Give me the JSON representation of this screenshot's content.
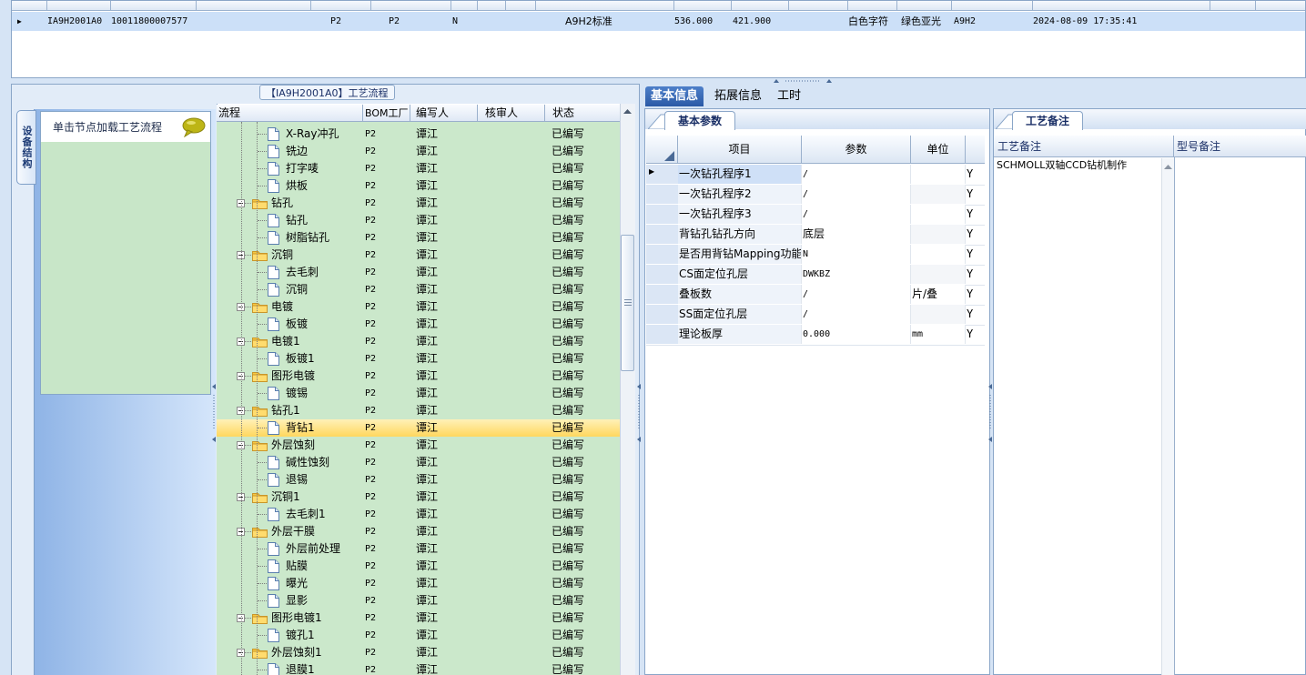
{
  "top_grid": {
    "row": {
      "id": "IA9H2001A0",
      "code": "10011800007577",
      "f1": "P2",
      "f2": "P2",
      "f3": "N",
      "standard": "A9H2标准",
      "v1": "536.000",
      "v2": "421.900",
      "char_color": "白色字符",
      "mask_color": "绿色亚光",
      "model": "A9H2",
      "datetime": "2024-08-09 17:35:41"
    }
  },
  "left_panel": {
    "title": "【IA9H2001A0】工艺流程",
    "vertical_tab": "设备结构",
    "load_hint": "单击节点加载工艺流程"
  },
  "tree": {
    "headers": [
      "流程",
      "BOM工厂",
      "编写人",
      "核审人",
      "状态"
    ],
    "rows": [
      {
        "name": "X-Ray冲孔",
        "level": 2,
        "bom": "P2",
        "author": "谭江",
        "reviewer": "",
        "status": "已编写"
      },
      {
        "name": "铣边",
        "level": 2,
        "bom": "P2",
        "author": "谭江",
        "reviewer": "",
        "status": "已编写"
      },
      {
        "name": "打字唛",
        "level": 2,
        "bom": "P2",
        "author": "谭江",
        "reviewer": "",
        "status": "已编写"
      },
      {
        "name": "烘板",
        "level": 2,
        "bom": "P2",
        "author": "谭江",
        "reviewer": "",
        "status": "已编写"
      },
      {
        "name": "钻孔",
        "level": 1,
        "bom": "P2",
        "author": "谭江",
        "reviewer": "",
        "status": "已编写"
      },
      {
        "name": "钻孔",
        "level": 2,
        "bom": "P2",
        "author": "谭江",
        "reviewer": "",
        "status": "已编写"
      },
      {
        "name": "树脂钻孔",
        "level": 2,
        "bom": "P2",
        "author": "谭江",
        "reviewer": "",
        "status": "已编写"
      },
      {
        "name": "沉铜",
        "level": 1,
        "bom": "P2",
        "author": "谭江",
        "reviewer": "",
        "status": "已编写"
      },
      {
        "name": "去毛刺",
        "level": 2,
        "bom": "P2",
        "author": "谭江",
        "reviewer": "",
        "status": "已编写"
      },
      {
        "name": "沉铜",
        "level": 2,
        "bom": "P2",
        "author": "谭江",
        "reviewer": "",
        "status": "已编写"
      },
      {
        "name": "电镀",
        "level": 1,
        "bom": "P2",
        "author": "谭江",
        "reviewer": "",
        "status": "已编写"
      },
      {
        "name": "板镀",
        "level": 2,
        "bom": "P2",
        "author": "谭江",
        "reviewer": "",
        "status": "已编写"
      },
      {
        "name": "电镀1",
        "level": 1,
        "bom": "P2",
        "author": "谭江",
        "reviewer": "",
        "status": "已编写"
      },
      {
        "name": "板镀1",
        "level": 2,
        "bom": "P2",
        "author": "谭江",
        "reviewer": "",
        "status": "已编写"
      },
      {
        "name": "图形电镀",
        "level": 1,
        "bom": "P2",
        "author": "谭江",
        "reviewer": "",
        "status": "已编写"
      },
      {
        "name": "镀锡",
        "level": 2,
        "bom": "P2",
        "author": "谭江",
        "reviewer": "",
        "status": "已编写"
      },
      {
        "name": "钻孔1",
        "level": 1,
        "bom": "P2",
        "author": "谭江",
        "reviewer": "",
        "status": "已编写"
      },
      {
        "name": "背钻1",
        "level": 2,
        "bom": "P2",
        "author": "谭江",
        "reviewer": "",
        "status": "已编写",
        "selected": true
      },
      {
        "name": "外层蚀刻",
        "level": 1,
        "bom": "P2",
        "author": "谭江",
        "reviewer": "",
        "status": "已编写"
      },
      {
        "name": "碱性蚀刻",
        "level": 2,
        "bom": "P2",
        "author": "谭江",
        "reviewer": "",
        "status": "已编写"
      },
      {
        "name": "退锡",
        "level": 2,
        "bom": "P2",
        "author": "谭江",
        "reviewer": "",
        "status": "已编写"
      },
      {
        "name": "沉铜1",
        "level": 1,
        "bom": "P2",
        "author": "谭江",
        "reviewer": "",
        "status": "已编写"
      },
      {
        "name": "去毛刺1",
        "level": 2,
        "bom": "P2",
        "author": "谭江",
        "reviewer": "",
        "status": "已编写"
      },
      {
        "name": "外层干膜",
        "level": 1,
        "bom": "P2",
        "author": "谭江",
        "reviewer": "",
        "status": "已编写"
      },
      {
        "name": "外层前处理",
        "level": 2,
        "bom": "P2",
        "author": "谭江",
        "reviewer": "",
        "status": "已编写"
      },
      {
        "name": "贴膜",
        "level": 2,
        "bom": "P2",
        "author": "谭江",
        "reviewer": "",
        "status": "已编写"
      },
      {
        "name": "曝光",
        "level": 2,
        "bom": "P2",
        "author": "谭江",
        "reviewer": "",
        "status": "已编写"
      },
      {
        "name": "显影",
        "level": 2,
        "bom": "P2",
        "author": "谭江",
        "reviewer": "",
        "status": "已编写"
      },
      {
        "name": "图形电镀1",
        "level": 1,
        "bom": "P2",
        "author": "谭江",
        "reviewer": "",
        "status": "已编写"
      },
      {
        "name": "镀孔1",
        "level": 2,
        "bom": "P2",
        "author": "谭江",
        "reviewer": "",
        "status": "已编写"
      },
      {
        "name": "外层蚀刻1",
        "level": 1,
        "bom": "P2",
        "author": "谭江",
        "reviewer": "",
        "status": "已编写"
      },
      {
        "name": "退膜1",
        "level": 2,
        "bom": "P2",
        "author": "谭江",
        "reviewer": "",
        "status": "已编写"
      }
    ]
  },
  "right_tabs": [
    "基本信息",
    "拓展信息",
    "工时"
  ],
  "params": {
    "subtab": "基本参数",
    "headers": [
      "项目",
      "参数",
      "单位"
    ],
    "rows": [
      {
        "item": "一次钻孔程序1",
        "value": "/",
        "unit": "",
        "flag": "Y",
        "current": true
      },
      {
        "item": "一次钻孔程序2",
        "value": "/",
        "unit": "",
        "flag": "Y"
      },
      {
        "item": "一次钻孔程序3",
        "value": "/",
        "unit": "",
        "flag": "Y"
      },
      {
        "item": "背钻孔钻孔方向",
        "value": "底层",
        "unit": "",
        "flag": "Y"
      },
      {
        "item": "是否用背钻Mapping功能",
        "value": "N",
        "unit": "",
        "flag": "Y"
      },
      {
        "item": "CS面定位孔层",
        "value": "DWKBZ",
        "unit": "",
        "flag": "Y"
      },
      {
        "item": "叠板数",
        "value": "/",
        "unit": "片/叠",
        "flag": "Y"
      },
      {
        "item": "SS面定位孔层",
        "value": "/",
        "unit": "",
        "flag": "Y"
      },
      {
        "item": "理论板厚",
        "value": "0.000",
        "unit": "mm",
        "flag": "Y"
      }
    ]
  },
  "notes": {
    "subtab": "工艺备注",
    "headers": [
      "工艺备注",
      "型号备注"
    ],
    "process_note": "SCHMOLL双轴CCD钻机制作"
  },
  "colors": {
    "tree_bg": "#cbe8cb",
    "selection": "#ffd75e",
    "accent": "#2b5aa6",
    "top_selected_row": "#cce0f8"
  }
}
